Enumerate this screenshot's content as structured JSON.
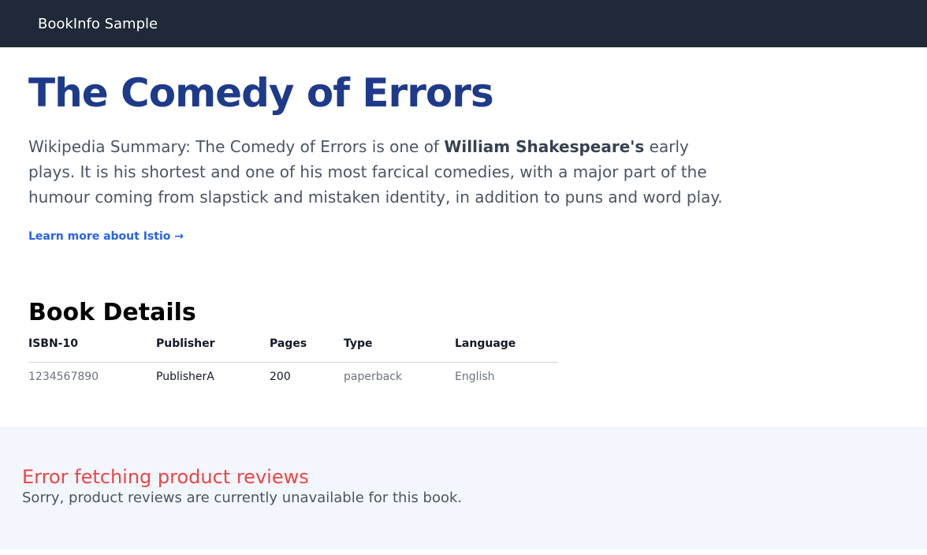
{
  "header": {
    "brand": "BookInfo Sample"
  },
  "book": {
    "title": "The Comedy of Errors",
    "summary_prefix": "Wikipedia Summary: The Comedy of Errors is one of ",
    "summary_bold": "William Shakespeare's",
    "summary_suffix": " early plays. It is his shortest and one of his most farcical comedies, with a major part of the humour coming from slapstick and mistaken identity, in addition to puns and word play.",
    "learn_more": "Learn more about Istio →"
  },
  "details": {
    "heading": "Book Details",
    "columns": [
      "ISBN-10",
      "Publisher",
      "Pages",
      "Type",
      "Language"
    ],
    "row": [
      "1234567890",
      "PublisherA",
      "200",
      "paperback",
      "English"
    ]
  },
  "reviews": {
    "error_title": "Error fetching product reviews",
    "error_message": "Sorry, product reviews are currently unavailable for this book."
  }
}
